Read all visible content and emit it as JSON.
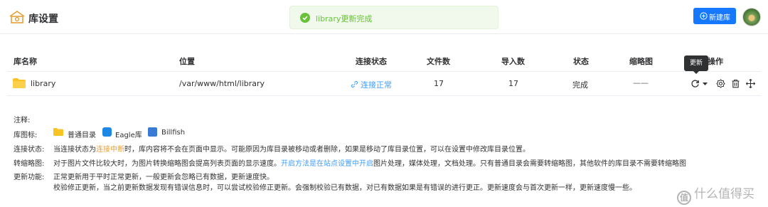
{
  "header": {
    "title": "库设置",
    "toast": "library更新完成",
    "new_button": "新建库"
  },
  "table": {
    "columns": [
      "库名称",
      "位置",
      "连接状态",
      "文件数",
      "导入数",
      "状态",
      "缩略图",
      "操作"
    ],
    "rows": [
      {
        "name": "library",
        "location": "/var/www/html/library",
        "connection": "连接正常",
        "files": "17",
        "imported": "17",
        "status": "完成",
        "thumbnail": "——"
      }
    ],
    "tooltip": "更新"
  },
  "notes": {
    "heading": "注释:",
    "lib_icon_label": "库图标:",
    "lib_types": [
      "普通目录",
      "Eagle库",
      "Billfish"
    ],
    "conn_label": "连接状态:",
    "conn_text_a": "当连接状态为",
    "conn_text_highlight": "连接中断",
    "conn_text_b": "时，库内容将不会在页面中显示。可能原因为库目录被移动或者删除，如果是移动了库目录位置，可以在设置中修改库目录位置。",
    "thumb_label": "转缩略图:",
    "thumb_text_a": "对于图片文件比较大时，为图片转换缩略图会提高列表页面的显示速度。",
    "thumb_text_link": "开启方法是在站点设置中开启",
    "thumb_text_b": "图片处理，媒体处理，文档处理。只有普通目录会需要转缩略图，其他软件的库目录不需要转缩略图",
    "update_label": "更新功能:",
    "update_line1": "正常更新用于平时正常更新，一般更新会忽略已有数据，更新速度快。",
    "update_line2": "校验修正更新，当之前更新数据发现有错误信息时，可以尝试校验修正更新。会强制校验已有数据，对已有数据如果是有错误的进行更正。更新速度会与首次更新一样，更新速度慢一些。"
  },
  "watermark": "什么值得买",
  "colors": {
    "primary": "#1677ff",
    "link": "#409eff",
    "success": "#67c23a",
    "warning": "#e6a23c"
  },
  "icons": [
    "house-logo-icon",
    "check-circle-icon",
    "plus-circle-icon",
    "folder-icon",
    "link-icon",
    "refresh-icon",
    "caret-down-icon",
    "gear-icon",
    "trash-icon",
    "move-icon",
    "eagle-icon",
    "billfish-icon"
  ]
}
